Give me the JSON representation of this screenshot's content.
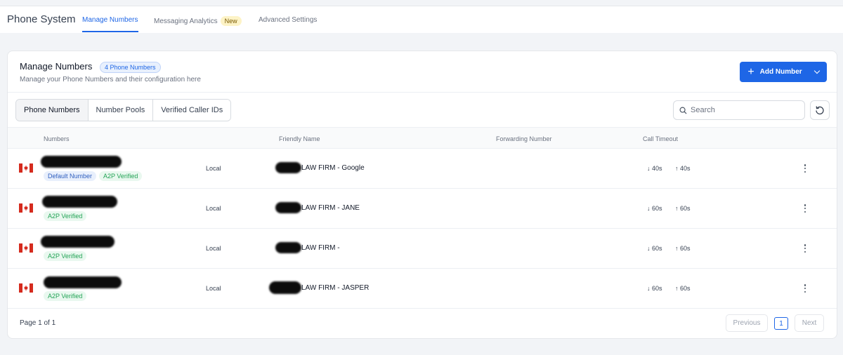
{
  "app": {
    "title": "Phone System",
    "tabs": [
      {
        "label": "Manage Numbers",
        "active": true
      },
      {
        "label": "Messaging Analytics",
        "badge": "New"
      },
      {
        "label": "Advanced Settings"
      }
    ]
  },
  "card": {
    "title": "Manage Numbers",
    "count_badge": "4 Phone Numbers",
    "subtitle": "Manage your Phone Numbers and their configuration here",
    "add_button": "Add Number"
  },
  "subtabs": [
    "Phone Numbers",
    "Number Pools",
    "Verified Caller IDs"
  ],
  "search": {
    "placeholder": "Search"
  },
  "table": {
    "headers": [
      "Numbers",
      "Friendly Name",
      "Forwarding Number",
      "Call Timeout"
    ],
    "rows": [
      {
        "country": "canada-flag-icon",
        "badges": [
          "Default Number",
          "A2P Verified"
        ],
        "type": "Local",
        "friendly_name": "LAW FIRM - Google",
        "timeout_in": "40s",
        "timeout_out": "40s"
      },
      {
        "country": "canada-flag-icon",
        "badges": [
          "A2P Verified"
        ],
        "type": "Local",
        "friendly_name": "LAW FIRM - JANE",
        "timeout_in": "60s",
        "timeout_out": "60s"
      },
      {
        "country": "canada-flag-icon",
        "badges": [
          "A2P Verified"
        ],
        "type": "Local",
        "friendly_name": "LAW FIRM -",
        "timeout_in": "60s",
        "timeout_out": "60s"
      },
      {
        "country": "canada-flag-icon",
        "badges": [
          "A2P Verified"
        ],
        "type": "Local",
        "friendly_name": "LAW FIRM - JASPER",
        "timeout_in": "60s",
        "timeout_out": "60s"
      }
    ]
  },
  "pagination": {
    "page_text": "Page 1 of 1",
    "previous": "Previous",
    "current": "1",
    "next": "Next"
  },
  "colors": {
    "accent": "#1e66e6",
    "a2p_green": "#22a355",
    "flag_red": "#d52b1e"
  }
}
